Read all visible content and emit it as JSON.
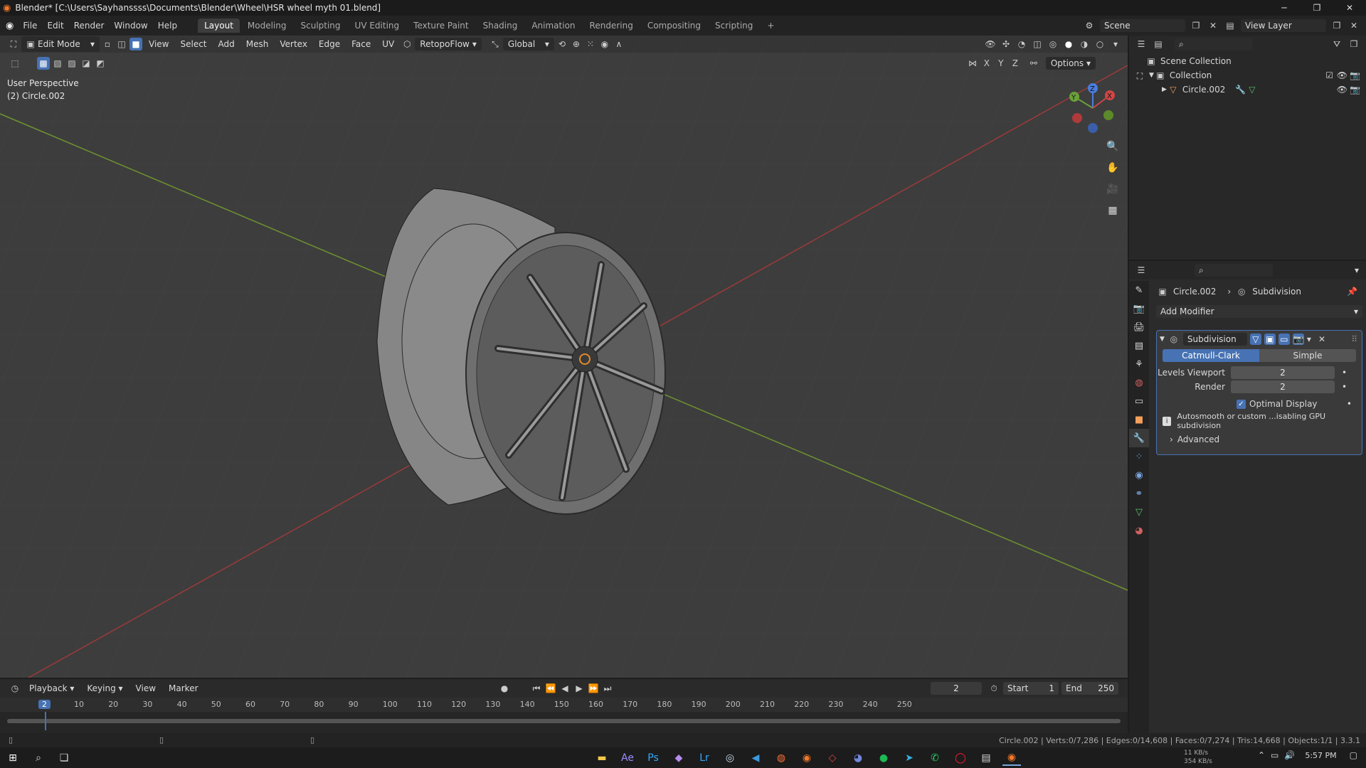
{
  "window": {
    "title": "Blender* [C:\\Users\\Sayhanssss\\Documents\\Blender\\Wheel\\HSR wheel myth 01.blend]",
    "minimize": "─",
    "maximize": "❐",
    "close": "✕"
  },
  "menubar": {
    "menus": [
      "File",
      "Edit",
      "Render",
      "Window",
      "Help"
    ],
    "workspaces": [
      "Layout",
      "Modeling",
      "Sculpting",
      "UV Editing",
      "Texture Paint",
      "Shading",
      "Animation",
      "Rendering",
      "Compositing",
      "Scripting"
    ],
    "active_workspace": "Layout",
    "add_tab": "+",
    "scene_label": "Scene",
    "view_layer_label": "View Layer"
  },
  "viewport_header": {
    "mode": "Edit Mode",
    "menus": [
      "View",
      "Select",
      "Add",
      "Mesh",
      "Vertex",
      "Edge",
      "Face",
      "UV"
    ],
    "addon": "RetopoFlow",
    "orientation": "Global",
    "axis_x": "X",
    "axis_y": "Y",
    "axis_z": "Z",
    "options": "Options"
  },
  "viewport_overlay": {
    "perspective": "User Perspective",
    "object": "(2) Circle.002"
  },
  "outliner": {
    "root": "Scene Collection",
    "collection": "Collection",
    "object": "Circle.002"
  },
  "properties": {
    "breadcrumb_object": "Circle.002",
    "breadcrumb_modifier": "Subdivision",
    "add_modifier": "Add Modifier",
    "modifier_name": "Subdivision",
    "method_catmull": "Catmull-Clark",
    "method_simple": "Simple",
    "levels_viewport_label": "Levels Viewport",
    "levels_viewport_value": "2",
    "render_label": "Render",
    "render_value": "2",
    "optimal_display": "Optimal Display",
    "optimal_display_checked": true,
    "info_text": "Autosmooth or custom ...isabling GPU subdivision",
    "advanced": "Advanced"
  },
  "timeline": {
    "menus": [
      "Playback",
      "Keying",
      "View",
      "Marker"
    ],
    "current_frame": "2",
    "start_label": "Start",
    "start_value": "1",
    "end_label": "End",
    "end_value": "250",
    "ticks": [
      "2",
      "10",
      "20",
      "30",
      "40",
      "50",
      "60",
      "70",
      "80",
      "90",
      "100",
      "110",
      "120",
      "130",
      "140",
      "150",
      "160",
      "170",
      "180",
      "190",
      "200",
      "210",
      "220",
      "230",
      "240",
      "250"
    ]
  },
  "statusbar": {
    "stats": "Circle.002 | Verts:0/7,286 | Edges:0/14,608 | Faces:0/7,274 | Tris:14,668 | Objects:1/1 | 3.3.1"
  },
  "taskbar": {
    "net_up": "11 KB/s",
    "net_down": "354 KB/s",
    "time": "5:57 PM"
  },
  "colors": {
    "accent": "#4772b3",
    "viewport_bg": "#3d3d3d",
    "x_axis": "#a83a3a",
    "y_axis": "#7aa12f"
  }
}
